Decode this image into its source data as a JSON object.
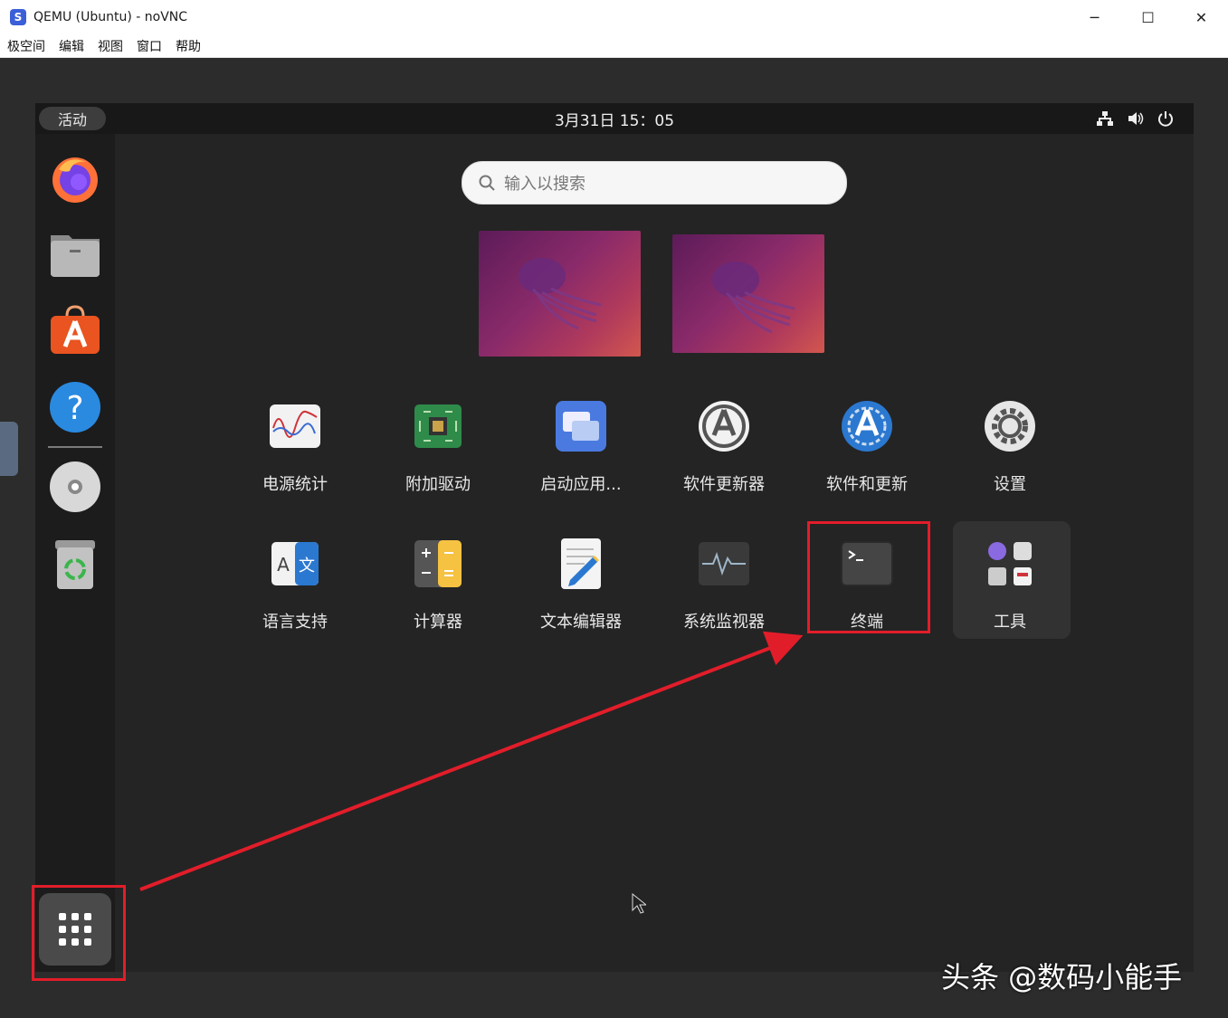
{
  "window": {
    "title": "QEMU (Ubuntu) - noVNC",
    "controls": {
      "minimize": "─",
      "maximize": "☐",
      "close": "✕"
    }
  },
  "menu": [
    {
      "label": "极空间"
    },
    {
      "label": "编辑"
    },
    {
      "label": "视图"
    },
    {
      "label": "窗口"
    },
    {
      "label": "帮助"
    }
  ],
  "topbar": {
    "activities": "活动",
    "clock": "3月31日 15：05"
  },
  "search": {
    "placeholder": "输入以搜索"
  },
  "dock": [
    {
      "name": "firefox-icon"
    },
    {
      "name": "files-icon"
    },
    {
      "name": "app-center-icon"
    },
    {
      "name": "help-icon"
    },
    {
      "name": "disc-icon"
    },
    {
      "name": "trash-icon"
    }
  ],
  "apps": [
    {
      "label": "电源统计",
      "icon": "power-statistics-icon"
    },
    {
      "label": "附加驱动",
      "icon": "additional-drivers-icon"
    },
    {
      "label": "启动应用...",
      "icon": "startup-apps-icon"
    },
    {
      "label": "软件更新器",
      "icon": "software-updater-icon"
    },
    {
      "label": "软件和更新",
      "icon": "software-and-updates-icon"
    },
    {
      "label": "设置",
      "icon": "settings-icon"
    },
    {
      "label": "语言支持",
      "icon": "language-support-icon"
    },
    {
      "label": "计算器",
      "icon": "calculator-icon"
    },
    {
      "label": "文本编辑器",
      "icon": "text-editor-icon"
    },
    {
      "label": "系统监视器",
      "icon": "system-monitor-icon"
    },
    {
      "label": "终端",
      "icon": "terminal-icon"
    },
    {
      "label": "工具",
      "icon": "utilities-folder-icon"
    }
  ],
  "watermark": "头条 @数码小能手",
  "colors": {
    "highlight": "#e21d2a",
    "ubuntu_orange": "#e95420"
  }
}
